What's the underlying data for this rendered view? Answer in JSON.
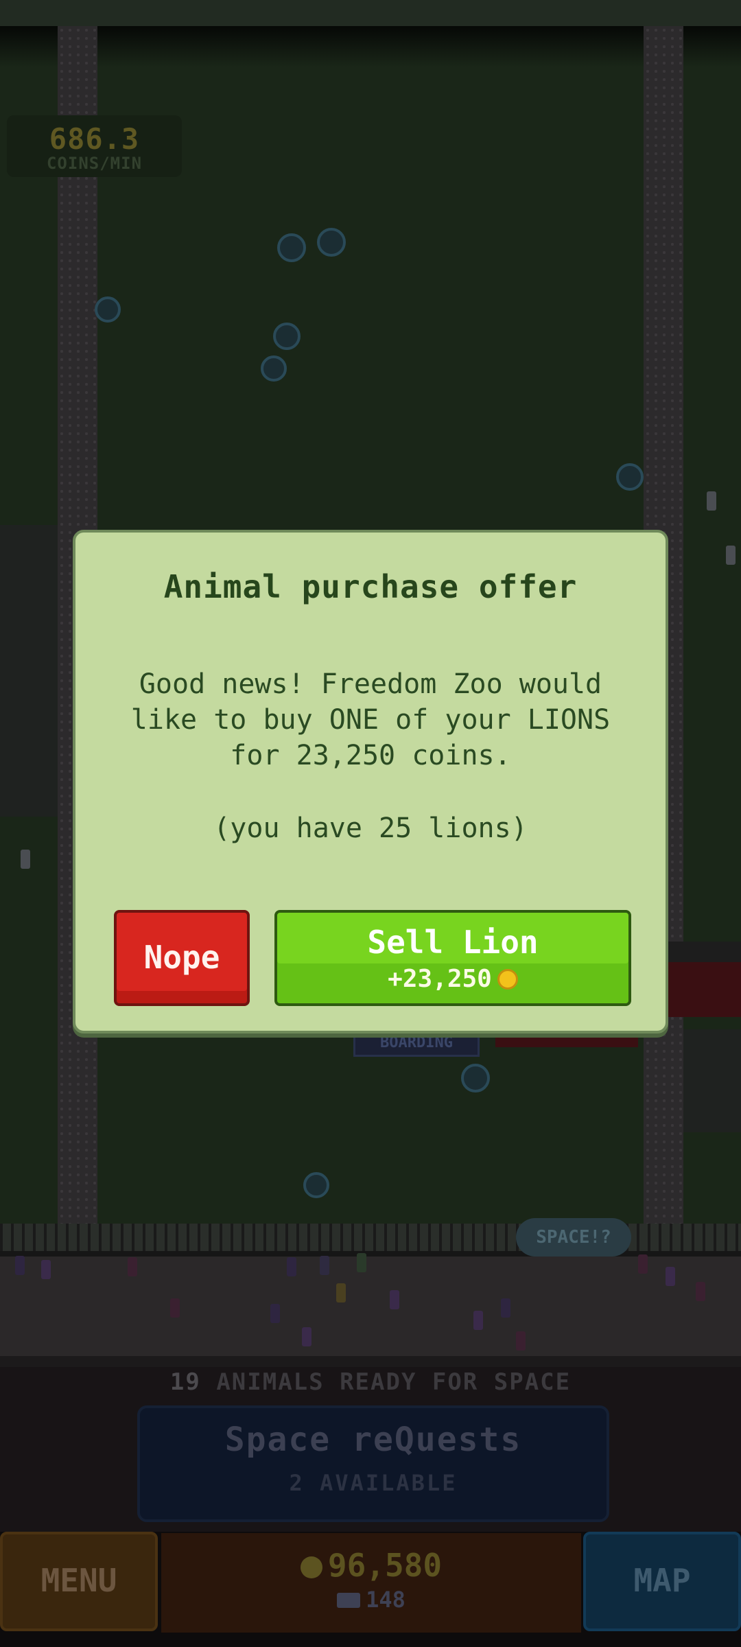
{
  "hud": {
    "coins_per_min": "686.3",
    "coins_per_min_unit": "COINS/MIN"
  },
  "world": {
    "space_bubble": "SPACE!?",
    "boarding_sign": "BOARDING"
  },
  "dialog": {
    "title": "Animal purchase offer",
    "body": "Good news! Freedom Zoo would like to buy ONE of your LIONS for 23,250 coins.",
    "note": "(you have 25 lions)",
    "nope_label": "Nope",
    "sell_label": "Sell Lion",
    "sell_amount": "+23,250",
    "coin_icon": "coin-icon",
    "colors": {
      "panel": "#c4da9f",
      "nope": "#d8261f",
      "sell": "#78d41f"
    }
  },
  "bottom": {
    "ready_count": "19",
    "ready_text": "ANIMALS READY FOR SPACE",
    "requests_title": "Space reQuests",
    "requests_sub": "2 AVAILABLE",
    "menu_label": "MENU",
    "coins": "96,580",
    "tickets": "148",
    "map_label": "MAP"
  }
}
